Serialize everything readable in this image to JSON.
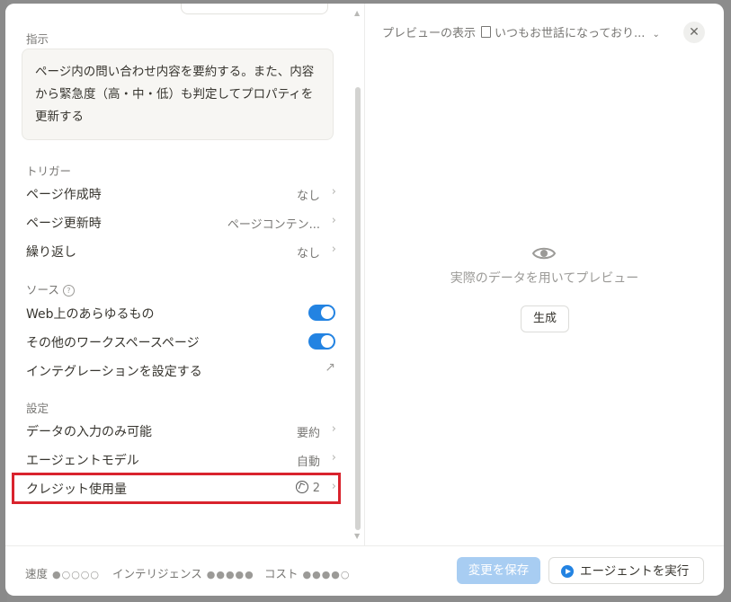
{
  "instructions": {
    "label": "指示",
    "text": "ページ内の問い合わせ内容を要約する。また、内容から緊急度（高・中・低）も判定してプロパティを更新する"
  },
  "triggers": {
    "label": "トリガー",
    "items": [
      {
        "label": "ページ作成時",
        "value": "なし"
      },
      {
        "label": "ページ更新時",
        "value": "ページコンテン..."
      },
      {
        "label": "繰り返し",
        "value": "なし"
      }
    ]
  },
  "sources": {
    "label": "ソース",
    "items": [
      {
        "label": "Web上のあらゆるもの",
        "enabled": true
      },
      {
        "label": "その他のワークスペースページ",
        "enabled": true
      }
    ],
    "integration_label": "インテグレーションを設定する"
  },
  "settings": {
    "label": "設定",
    "items": [
      {
        "label": "データの入力のみ可能",
        "value": "要約"
      },
      {
        "label": "エージェントモデル",
        "value": "自動"
      },
      {
        "label": "クレジット使用量",
        "value": "2"
      }
    ]
  },
  "preview": {
    "header_label": "プレビューの表示",
    "page_title": "いつもお世話になっており...",
    "empty_text": "実際のデータを用いてプレビュー",
    "generate_label": "生成"
  },
  "footer": {
    "speed_label": "速度",
    "speed_dots": "●○○○○",
    "intelligence_label": "インテリジェンス",
    "intelligence_dots": "●●●●●",
    "cost_label": "コスト",
    "cost_dots": "●●●●○",
    "save_label": "変更を保存",
    "run_label": "エージェントを実行"
  },
  "colors": {
    "accent": "#2383e2",
    "highlight": "#d9232d",
    "save_disabled": "#a8cdf2"
  }
}
